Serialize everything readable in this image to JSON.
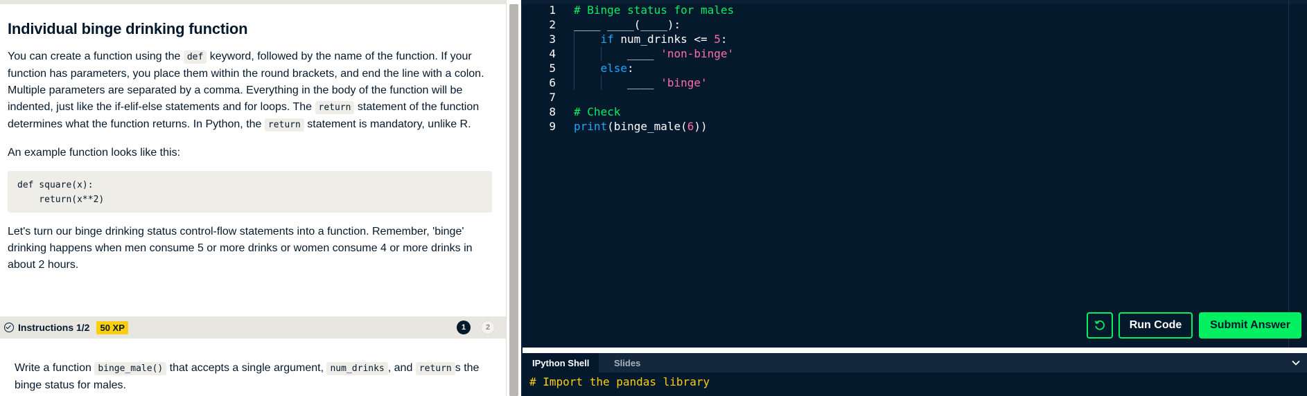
{
  "exercise": {
    "title": "Individual binge drinking function",
    "p1": [
      "You can create a function using the ",
      "def",
      " keyword, followed by the name of the function. If your function has parameters, you place them within the round brackets, and end the line with a colon. Multiple parameters are separated by a comma. Everything in the body of the function will be indented, just like the if-elif-else statements and for loops. The ",
      "return",
      " statement of the function determines what the function returns. In Python, the ",
      "return",
      " statement is mandatory, unlike R."
    ],
    "p2": "An example function looks like this:",
    "example_code": "def square(x):\n    return(x**2)",
    "p3": "Let's turn our binge drinking status control-flow statements into a function. Remember, 'binge' drinking happens when men consume 5 or more drinks or women consume 4 or more drinks in about 2 hours."
  },
  "instructions": {
    "label": "Instructions 1/2",
    "xp": "50 XP",
    "steps": [
      "1",
      "2"
    ],
    "text": [
      "Write a function ",
      "binge_male()",
      " that accepts a single argument, ",
      "num_drinks",
      ", and ",
      "return",
      "s the binge status for males."
    ]
  },
  "editor": {
    "lines": [
      {
        "n": "1",
        "indent": 0,
        "tokens": [
          {
            "t": "# Binge status for males",
            "c": "comment"
          }
        ]
      },
      {
        "n": "2",
        "indent": 0,
        "tokens": [
          {
            "t": "____ ____(____):",
            "c": "white"
          }
        ]
      },
      {
        "n": "3",
        "indent": 1,
        "tokens": [
          {
            "t": "if",
            "c": "kw"
          },
          {
            "t": " num_drinks <= ",
            "c": "white"
          },
          {
            "t": "5",
            "c": "num"
          },
          {
            "t": ":",
            "c": "white"
          }
        ]
      },
      {
        "n": "4",
        "indent": 2,
        "tokens": [
          {
            "t": "____ ",
            "c": "white"
          },
          {
            "t": "'non-binge'",
            "c": "str"
          }
        ]
      },
      {
        "n": "5",
        "indent": 1,
        "tokens": [
          {
            "t": "else",
            "c": "kw"
          },
          {
            "t": ":",
            "c": "white"
          }
        ]
      },
      {
        "n": "6",
        "indent": 2,
        "tokens": [
          {
            "t": "____ ",
            "c": "white"
          },
          {
            "t": "'binge'",
            "c": "str"
          }
        ]
      },
      {
        "n": "7",
        "indent": 0,
        "tokens": []
      },
      {
        "n": "8",
        "indent": 0,
        "tokens": [
          {
            "t": "# Check",
            "c": "comment"
          }
        ]
      },
      {
        "n": "9",
        "indent": 0,
        "tokens": [
          {
            "t": "print",
            "c": "kw"
          },
          {
            "t": "(binge_male(",
            "c": "white"
          },
          {
            "t": "6",
            "c": "num"
          },
          {
            "t": "))",
            "c": "white"
          }
        ]
      }
    ],
    "run_label": "Run Code",
    "submit_label": "Submit Answer"
  },
  "shell": {
    "tabs": [
      "IPython Shell",
      "Slides"
    ],
    "line1": "# Import the pandas library"
  },
  "colors": {
    "accent_green": "#03ef62",
    "navy": "#05192d",
    "xp_yellow": "#fcce0d",
    "keyword_blue": "#1ea7fd",
    "string_pink": "#ff6ea9"
  },
  "icons": {
    "instructions": "check-circle-icon",
    "reset": "reset-icon",
    "collapse": "chevron-down-icon"
  }
}
